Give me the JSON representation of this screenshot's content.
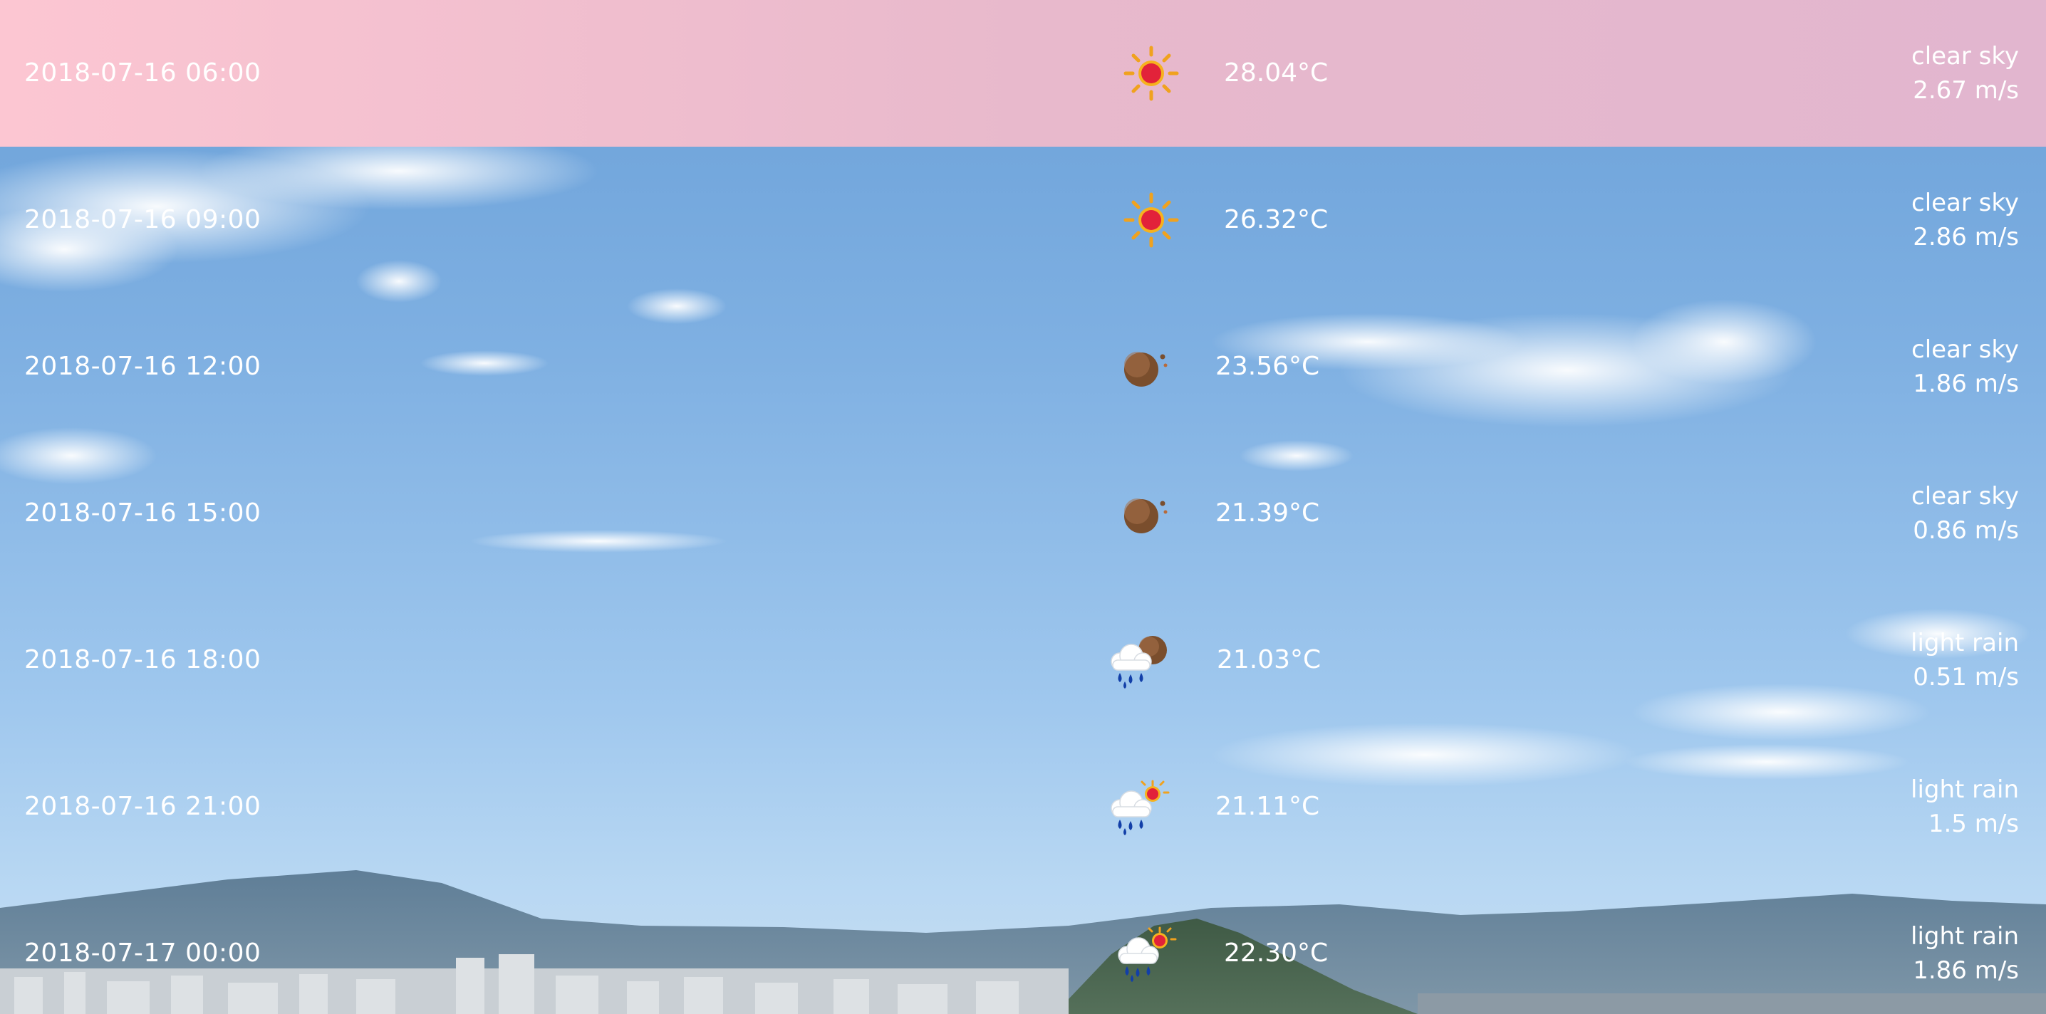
{
  "forecast": {
    "rows": [
      {
        "datetime": "2018-07-16 06:00",
        "icon": "sun-icon",
        "temperature": "28.04°C",
        "description": "clear sky",
        "wind": "2.67 m/s",
        "highlighted": true
      },
      {
        "datetime": "2018-07-16 09:00",
        "icon": "sun-icon",
        "temperature": "26.32°C",
        "description": "clear sky",
        "wind": "2.86 m/s",
        "highlighted": false
      },
      {
        "datetime": "2018-07-16 12:00",
        "icon": "moon-icon",
        "temperature": "23.56°C",
        "description": "clear sky",
        "wind": "1.86 m/s",
        "highlighted": false
      },
      {
        "datetime": "2018-07-16 15:00",
        "icon": "moon-icon",
        "temperature": "21.39°C",
        "description": "clear sky",
        "wind": "0.86 m/s",
        "highlighted": false
      },
      {
        "datetime": "2018-07-16 18:00",
        "icon": "rain-night-icon",
        "temperature": "21.03°C",
        "description": "light rain",
        "wind": "0.51 m/s",
        "highlighted": false
      },
      {
        "datetime": "2018-07-16 21:00",
        "icon": "rain-day-icon",
        "temperature": "21.11°C",
        "description": "light rain",
        "wind": "1.5 m/s",
        "highlighted": false
      },
      {
        "datetime": "2018-07-17 00:00",
        "icon": "rain-day-icon",
        "temperature": "22.30°C",
        "description": "light rain",
        "wind": "1.86 m/s",
        "highlighted": false
      }
    ]
  },
  "colors": {
    "highlight": "#f5c0d0",
    "sky": "#7fb0e2",
    "text": "#ffffff"
  }
}
